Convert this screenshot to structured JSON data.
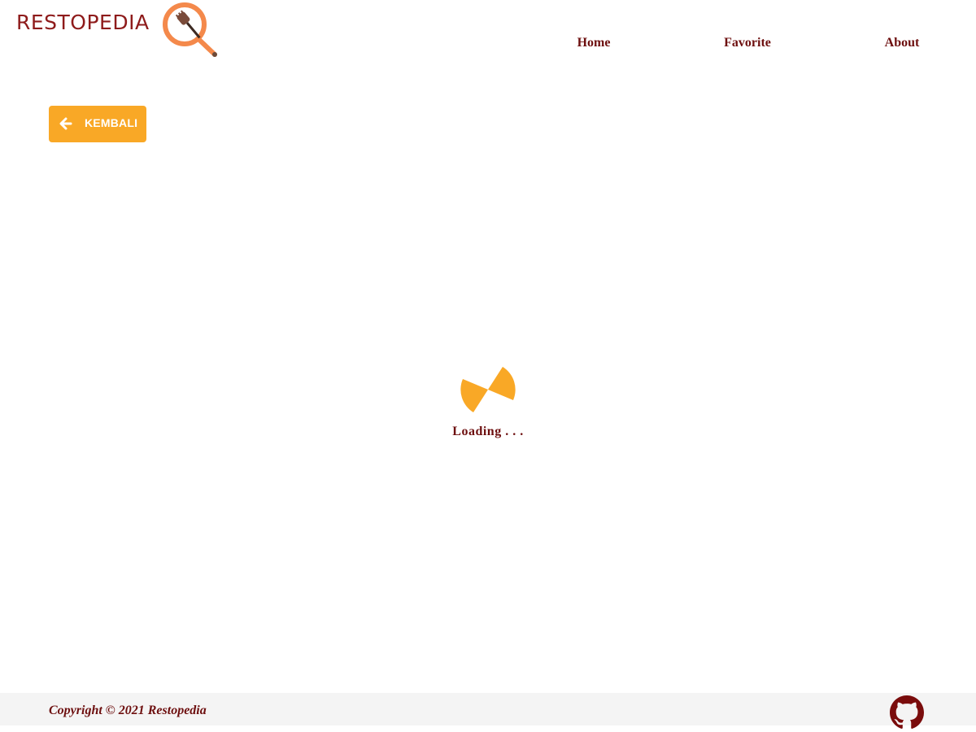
{
  "brand": {
    "name": "RESTOPEDIA",
    "logo_icon": "magnifier-fork-icon"
  },
  "nav": {
    "items": [
      {
        "label": "Home"
      },
      {
        "label": "Favorite"
      },
      {
        "label": "About"
      }
    ]
  },
  "back_button": {
    "label": "KEMBALI",
    "icon": "arrow-left-icon"
  },
  "loader": {
    "icon": "spinner-icon",
    "text": "Loading . . ."
  },
  "footer": {
    "copyright": "Copyright © 2021 Restopedia",
    "github_icon": "github-icon"
  },
  "colors": {
    "brand_dark_red": "#6d0f0f",
    "accent_orange": "#f9a826",
    "logo_orange": "#f4894b",
    "footer_bg": "#f4f4f4"
  }
}
